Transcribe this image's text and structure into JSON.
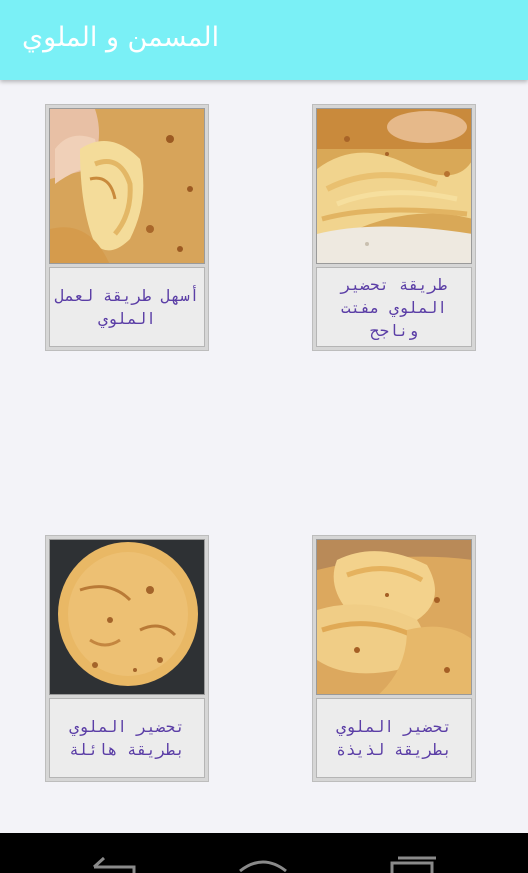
{
  "app_bar": {
    "title": "المسمن و الملوي",
    "background": "#7af0f6"
  },
  "cards": [
    {
      "caption": "طريقة تحضير الملوي مفتت وناجح",
      "image": "layered-bread-photo"
    },
    {
      "caption": "أسهل طريقة لعمل الملوي",
      "image": "folded-bread-in-hand-photo"
    },
    {
      "caption": "تحضير الملوي بطريقة لذيذة",
      "image": "layered-bread-stack-photo"
    },
    {
      "caption": "تحضير الملوي بطريقة هائلة",
      "image": "round-flatbread-photo"
    }
  ],
  "nav": {
    "back_icon": "back-icon",
    "home_icon": "home-icon",
    "recents_icon": "recents-icon"
  },
  "colors": {
    "caption_text": "#5b3ea6",
    "page_background": "#f3f3f8"
  }
}
